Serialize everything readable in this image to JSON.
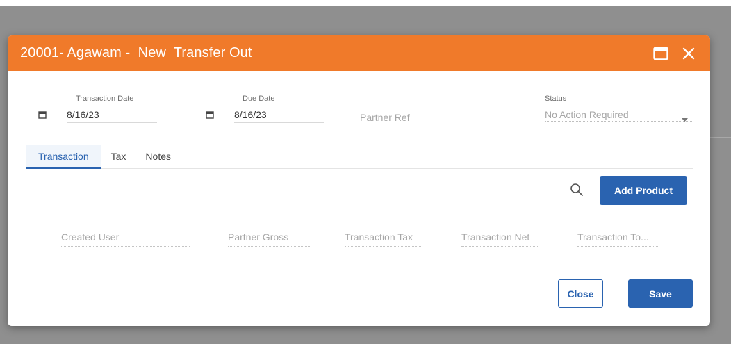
{
  "dialog": {
    "title": "20001- Agawam -  New  Transfer Out",
    "header_color": "#f07a2a",
    "accent_color": "#2a63b0",
    "icons": {
      "maximize": "maximize-icon",
      "close": "close-icon"
    }
  },
  "form": {
    "transaction_date": {
      "label": "Transaction Date",
      "value": "8/16/23",
      "icon": "calendar-icon"
    },
    "due_date": {
      "label": "Due Date",
      "value": "8/16/23",
      "icon": "calendar-icon"
    },
    "partner_ref": {
      "placeholder": "Partner Ref"
    },
    "status": {
      "label": "Status",
      "value": "No Action Required",
      "icon": "chevron-down-icon"
    }
  },
  "tabs": [
    {
      "label": "Transaction",
      "active": true
    },
    {
      "label": "Tax",
      "active": false
    },
    {
      "label": "Notes",
      "active": false
    }
  ],
  "toolbar": {
    "search_icon": "search-icon",
    "add_product_label": "Add Product"
  },
  "summary": {
    "created_user": "Created User",
    "partner_gross": "Partner Gross",
    "transaction_tax": "Transaction Tax",
    "transaction_net": "Transaction Net",
    "transaction_total": "Transaction To..."
  },
  "footer": {
    "close_label": "Close",
    "save_label": "Save"
  }
}
